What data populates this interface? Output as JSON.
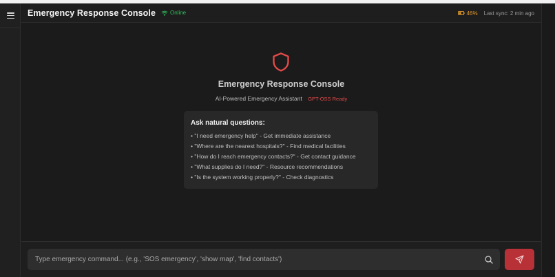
{
  "header": {
    "title": "Emergency Response Console",
    "status": "Online",
    "battery": "46%",
    "last_sync": "Last sync: 2 min ago"
  },
  "hero": {
    "title": "Emergency Response Console",
    "subtitle": "AI-Powered Emergency Assistant",
    "badge": "GPT-OSS Ready"
  },
  "card": {
    "title": "Ask natural questions:",
    "items": [
      "• \"I need emergency help\" - Get immediate assistance",
      "• \"Where are the nearest hospitals?\" - Find medical facilities",
      "• \"How do I reach emergency contacts?\" - Get contact guidance",
      "• \"What supplies do I need?\" - Resource recommendations",
      "• \"Is the system working properly?\" - Check diagnostics"
    ]
  },
  "command": {
    "placeholder": "Type emergency command... (e.g., 'SOS emergency', 'show map', 'find contacts')"
  },
  "colors": {
    "accent": "#e14a48",
    "send_button": "#b73136",
    "online": "#2fbf5a",
    "battery": "#e39a2a"
  },
  "icons": {
    "menu": "menu-icon",
    "status": "wifi-icon",
    "battery": "battery-icon",
    "hero": "shield-icon",
    "search": "search-icon",
    "send": "send-icon"
  }
}
